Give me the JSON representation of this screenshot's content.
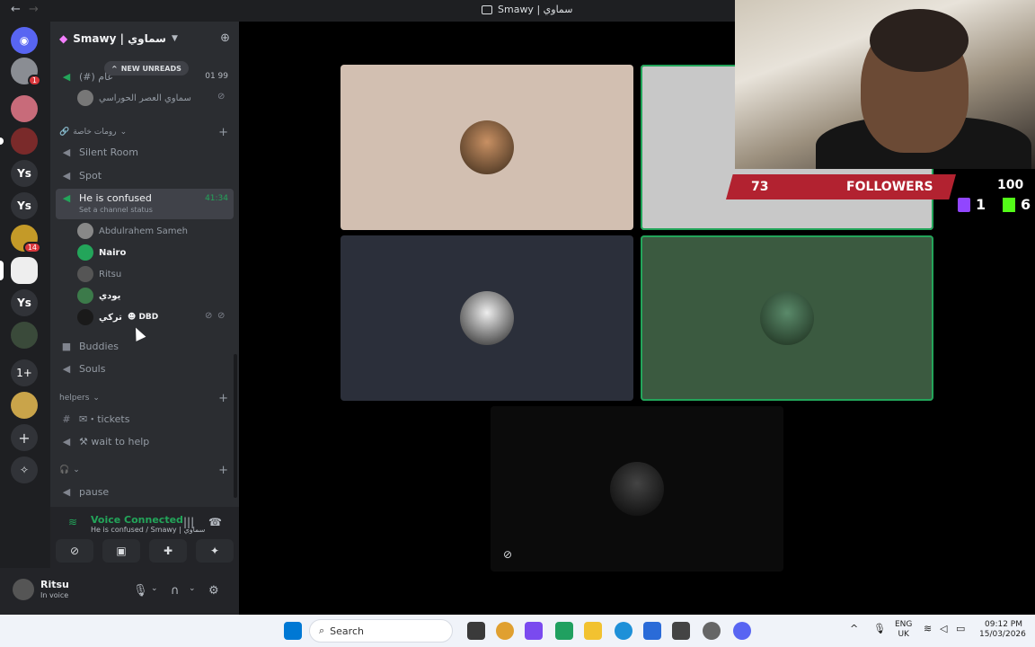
{
  "window": {
    "title": "Smawy | سماوي"
  },
  "server": {
    "name": "Smawy | سماوي"
  },
  "unreads": {
    "label": "NEW UNREADS"
  },
  "channels_top": [
    {
      "name": "(#) عام",
      "right": "01  99"
    },
    {
      "name": "سماوي العصر الحوراسي"
    }
  ],
  "categories": {
    "private_rooms": "رومات خاصة",
    "helpers": "helpers"
  },
  "voice_channels": [
    {
      "name": "Silent Room"
    },
    {
      "name": "Spot"
    },
    {
      "name": "He is confused",
      "status": "Set a channel status",
      "timer": "41:34"
    }
  ],
  "members": [
    {
      "name": "Abdulrahem Sameh"
    },
    {
      "name": "Nairo"
    },
    {
      "name": "Ritsu"
    },
    {
      "name": "يودي"
    },
    {
      "name": "تركي",
      "tag": "DBD"
    }
  ],
  "more_channels": [
    {
      "name": "Buddies"
    },
    {
      "name": "Souls"
    }
  ],
  "helper_channels": [
    {
      "name": "✉・tickets"
    },
    {
      "name": "⚒ wait to help"
    }
  ],
  "extra_channel": {
    "name": "pause"
  },
  "voice_panel": {
    "title": "Voice Connected",
    "subtitle": "He is confused / Smawy | سماوي"
  },
  "user": {
    "name": "Ritsu",
    "status": "In voice"
  },
  "overlay": {
    "followers_count": "73",
    "followers_label": "FOLLOWERS",
    "goal": "100",
    "twitch_count": "1",
    "kick_count": "6"
  },
  "taskbar": {
    "search_placeholder": "Search",
    "lang_line1": "ENG",
    "lang_line2": "UK",
    "time": "09:12 PM",
    "date": "15/03/2026"
  },
  "guild_labels": [
    "Ys",
    "Ys",
    "Ys",
    "1+"
  ],
  "guild_badges": [
    "1",
    "14"
  ],
  "colors": {
    "accent_green": "#23a55a",
    "followers_red": "#b22230",
    "twitch_purple": "#9146ff",
    "kick_green": "#53fc18"
  }
}
